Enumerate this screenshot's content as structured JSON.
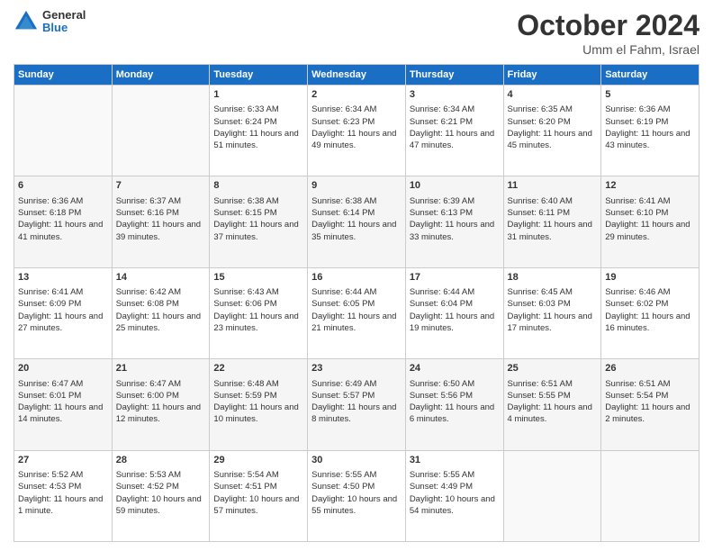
{
  "header": {
    "logo_line1": "General",
    "logo_line2": "Blue",
    "month_title": "October 2024",
    "location": "Umm el Fahm, Israel"
  },
  "days_of_week": [
    "Sunday",
    "Monday",
    "Tuesday",
    "Wednesday",
    "Thursday",
    "Friday",
    "Saturday"
  ],
  "weeks": [
    [
      {
        "day": "",
        "sunrise": "",
        "sunset": "",
        "daylight": ""
      },
      {
        "day": "",
        "sunrise": "",
        "sunset": "",
        "daylight": ""
      },
      {
        "day": "1",
        "sunrise": "Sunrise: 6:33 AM",
        "sunset": "Sunset: 6:24 PM",
        "daylight": "Daylight: 11 hours and 51 minutes."
      },
      {
        "day": "2",
        "sunrise": "Sunrise: 6:34 AM",
        "sunset": "Sunset: 6:23 PM",
        "daylight": "Daylight: 11 hours and 49 minutes."
      },
      {
        "day": "3",
        "sunrise": "Sunrise: 6:34 AM",
        "sunset": "Sunset: 6:21 PM",
        "daylight": "Daylight: 11 hours and 47 minutes."
      },
      {
        "day": "4",
        "sunrise": "Sunrise: 6:35 AM",
        "sunset": "Sunset: 6:20 PM",
        "daylight": "Daylight: 11 hours and 45 minutes."
      },
      {
        "day": "5",
        "sunrise": "Sunrise: 6:36 AM",
        "sunset": "Sunset: 6:19 PM",
        "daylight": "Daylight: 11 hours and 43 minutes."
      }
    ],
    [
      {
        "day": "6",
        "sunrise": "Sunrise: 6:36 AM",
        "sunset": "Sunset: 6:18 PM",
        "daylight": "Daylight: 11 hours and 41 minutes."
      },
      {
        "day": "7",
        "sunrise": "Sunrise: 6:37 AM",
        "sunset": "Sunset: 6:16 PM",
        "daylight": "Daylight: 11 hours and 39 minutes."
      },
      {
        "day": "8",
        "sunrise": "Sunrise: 6:38 AM",
        "sunset": "Sunset: 6:15 PM",
        "daylight": "Daylight: 11 hours and 37 minutes."
      },
      {
        "day": "9",
        "sunrise": "Sunrise: 6:38 AM",
        "sunset": "Sunset: 6:14 PM",
        "daylight": "Daylight: 11 hours and 35 minutes."
      },
      {
        "day": "10",
        "sunrise": "Sunrise: 6:39 AM",
        "sunset": "Sunset: 6:13 PM",
        "daylight": "Daylight: 11 hours and 33 minutes."
      },
      {
        "day": "11",
        "sunrise": "Sunrise: 6:40 AM",
        "sunset": "Sunset: 6:11 PM",
        "daylight": "Daylight: 11 hours and 31 minutes."
      },
      {
        "day": "12",
        "sunrise": "Sunrise: 6:41 AM",
        "sunset": "Sunset: 6:10 PM",
        "daylight": "Daylight: 11 hours and 29 minutes."
      }
    ],
    [
      {
        "day": "13",
        "sunrise": "Sunrise: 6:41 AM",
        "sunset": "Sunset: 6:09 PM",
        "daylight": "Daylight: 11 hours and 27 minutes."
      },
      {
        "day": "14",
        "sunrise": "Sunrise: 6:42 AM",
        "sunset": "Sunset: 6:08 PM",
        "daylight": "Daylight: 11 hours and 25 minutes."
      },
      {
        "day": "15",
        "sunrise": "Sunrise: 6:43 AM",
        "sunset": "Sunset: 6:06 PM",
        "daylight": "Daylight: 11 hours and 23 minutes."
      },
      {
        "day": "16",
        "sunrise": "Sunrise: 6:44 AM",
        "sunset": "Sunset: 6:05 PM",
        "daylight": "Daylight: 11 hours and 21 minutes."
      },
      {
        "day": "17",
        "sunrise": "Sunrise: 6:44 AM",
        "sunset": "Sunset: 6:04 PM",
        "daylight": "Daylight: 11 hours and 19 minutes."
      },
      {
        "day": "18",
        "sunrise": "Sunrise: 6:45 AM",
        "sunset": "Sunset: 6:03 PM",
        "daylight": "Daylight: 11 hours and 17 minutes."
      },
      {
        "day": "19",
        "sunrise": "Sunrise: 6:46 AM",
        "sunset": "Sunset: 6:02 PM",
        "daylight": "Daylight: 11 hours and 16 minutes."
      }
    ],
    [
      {
        "day": "20",
        "sunrise": "Sunrise: 6:47 AM",
        "sunset": "Sunset: 6:01 PM",
        "daylight": "Daylight: 11 hours and 14 minutes."
      },
      {
        "day": "21",
        "sunrise": "Sunrise: 6:47 AM",
        "sunset": "Sunset: 6:00 PM",
        "daylight": "Daylight: 11 hours and 12 minutes."
      },
      {
        "day": "22",
        "sunrise": "Sunrise: 6:48 AM",
        "sunset": "Sunset: 5:59 PM",
        "daylight": "Daylight: 11 hours and 10 minutes."
      },
      {
        "day": "23",
        "sunrise": "Sunrise: 6:49 AM",
        "sunset": "Sunset: 5:57 PM",
        "daylight": "Daylight: 11 hours and 8 minutes."
      },
      {
        "day": "24",
        "sunrise": "Sunrise: 6:50 AM",
        "sunset": "Sunset: 5:56 PM",
        "daylight": "Daylight: 11 hours and 6 minutes."
      },
      {
        "day": "25",
        "sunrise": "Sunrise: 6:51 AM",
        "sunset": "Sunset: 5:55 PM",
        "daylight": "Daylight: 11 hours and 4 minutes."
      },
      {
        "day": "26",
        "sunrise": "Sunrise: 6:51 AM",
        "sunset": "Sunset: 5:54 PM",
        "daylight": "Daylight: 11 hours and 2 minutes."
      }
    ],
    [
      {
        "day": "27",
        "sunrise": "Sunrise: 5:52 AM",
        "sunset": "Sunset: 4:53 PM",
        "daylight": "Daylight: 11 hours and 1 minute."
      },
      {
        "day": "28",
        "sunrise": "Sunrise: 5:53 AM",
        "sunset": "Sunset: 4:52 PM",
        "daylight": "Daylight: 10 hours and 59 minutes."
      },
      {
        "day": "29",
        "sunrise": "Sunrise: 5:54 AM",
        "sunset": "Sunset: 4:51 PM",
        "daylight": "Daylight: 10 hours and 57 minutes."
      },
      {
        "day": "30",
        "sunrise": "Sunrise: 5:55 AM",
        "sunset": "Sunset: 4:50 PM",
        "daylight": "Daylight: 10 hours and 55 minutes."
      },
      {
        "day": "31",
        "sunrise": "Sunrise: 5:55 AM",
        "sunset": "Sunset: 4:49 PM",
        "daylight": "Daylight: 10 hours and 54 minutes."
      },
      {
        "day": "",
        "sunrise": "",
        "sunset": "",
        "daylight": ""
      },
      {
        "day": "",
        "sunrise": "",
        "sunset": "",
        "daylight": ""
      }
    ]
  ]
}
